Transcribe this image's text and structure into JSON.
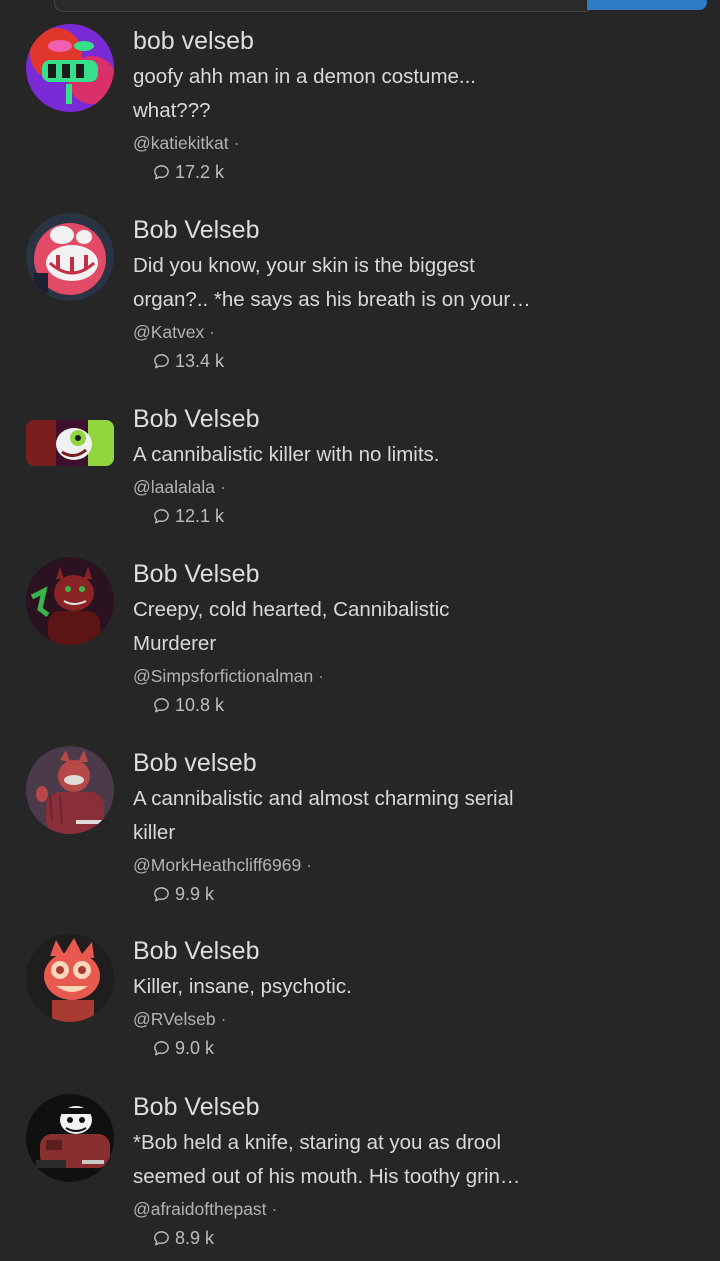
{
  "characters": [
    {
      "name": "bob velseb",
      "desc_lines": [
        "goofy ahh man in a demon costume...",
        "what???"
      ],
      "creator": "@katiekitkat",
      "chats": "17.2 k",
      "avatar_colors": [
        "#7a2bd6",
        "#e0362c",
        "#36e08a",
        "#f05fb0"
      ]
    },
    {
      "name": "Bob Velseb",
      "desc_lines": [
        "Did you know, your skin is the biggest",
        "organ?.. *he says as his breath is on your…"
      ],
      "creator": "@Katvex",
      "chats": "13.4 k",
      "avatar_colors": [
        "#e24b66",
        "#f2f2f2",
        "#2a3344",
        "#c52f45"
      ]
    },
    {
      "name": "Bob Velseb",
      "desc_lines": [
        "A cannibalistic killer with no limits."
      ],
      "creator": "@laalalala",
      "chats": "12.1 k",
      "avatar_colors": [
        "#7b1e1e",
        "#f0f0f0",
        "#8fd63f",
        "#3d0f2d"
      ]
    },
    {
      "name": "Bob Velseb",
      "desc_lines": [
        "Creepy, cold hearted, Cannibalistic",
        "Murderer"
      ],
      "creator": "@Simpsforfictionalman",
      "chats": "10.8 k",
      "avatar_colors": [
        "#2b1220",
        "#8a2424",
        "#3bb54a",
        "#5c1414"
      ]
    },
    {
      "name": "Bob velseb",
      "desc_lines": [
        "A cannibalistic and almost charming serial",
        "killer"
      ],
      "creator": "@MorkHeathcliff6969",
      "chats": "9.9 k",
      "avatar_colors": [
        "#4a3a4a",
        "#b74848",
        "#e0dada",
        "#8a2f3a"
      ]
    },
    {
      "name": "Bob Velseb",
      "desc_lines": [
        "Killer, insane, psychotic."
      ],
      "creator": "@RVelseb",
      "chats": "9.0 k",
      "avatar_colors": [
        "#1f1d1d",
        "#e85a4f",
        "#ffd6b8",
        "#a83a32"
      ]
    },
    {
      "name": "Bob Velseb",
      "desc_lines": [
        "*Bob held a knife, staring at you as drool",
        "seemed out of his mouth. His toothy grin…"
      ],
      "creator": "@afraidofthepast",
      "chats": "8.9 k",
      "avatar_colors": [
        "#101010",
        "#8a2f2f",
        "#f3f3f3",
        "#5a1f1f"
      ]
    }
  ],
  "icons": {
    "chat": "chat-bubble-icon"
  },
  "colors": {
    "background": "#262626",
    "accent": "#2f7cc8"
  }
}
